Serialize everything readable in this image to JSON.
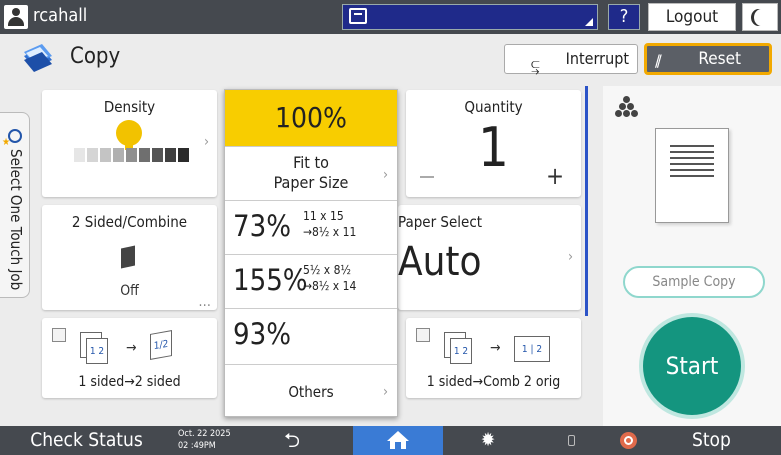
{
  "topbar": {
    "username": "rcahall",
    "help_label": "?",
    "logout_label": "Logout"
  },
  "header": {
    "title": "Copy",
    "interrupt_label": "Interrupt",
    "reset_label": "Reset"
  },
  "side_tab": {
    "label": "Select One Touch Job"
  },
  "density": {
    "title": "Density",
    "level": 0.55
  },
  "two_sided": {
    "title": "2 Sided/Combine",
    "value": "Off"
  },
  "presets": [
    {
      "label": "1 sided→2 sided",
      "checked": false
    },
    {
      "label": "1 sided→Comb 2 orig",
      "checked": false
    }
  ],
  "quantity": {
    "title": "Quantity",
    "value": "1",
    "plus": "+"
  },
  "paper_select": {
    "title": "Paper Select",
    "value": "Auto"
  },
  "ratio_menu": {
    "selected": "100%",
    "fit": [
      "Fit to",
      "Paper Size"
    ],
    "options": [
      {
        "value": "73%",
        "size_from": "11 x 15",
        "size_to": "→8½ x 11"
      },
      {
        "value": "155%",
        "size_from": "5½ x 8½",
        "size_to": "→8½ x 14"
      },
      {
        "value": "93%",
        "size_from": "",
        "size_to": ""
      }
    ],
    "others": "Others"
  },
  "right_panel": {
    "sample_copy": "Sample Copy",
    "start": "Start"
  },
  "bottombar": {
    "check_status": "Check Status",
    "date": "Oct. 22 2025",
    "time": "02 :49PM",
    "stop": "Stop"
  },
  "colors": {
    "accent_yellow": "#f8cd00",
    "start_green": "#14957f",
    "home_blue": "#3a7bd5",
    "bar_dark": "#45494f",
    "reset_border": "#f2a900"
  }
}
